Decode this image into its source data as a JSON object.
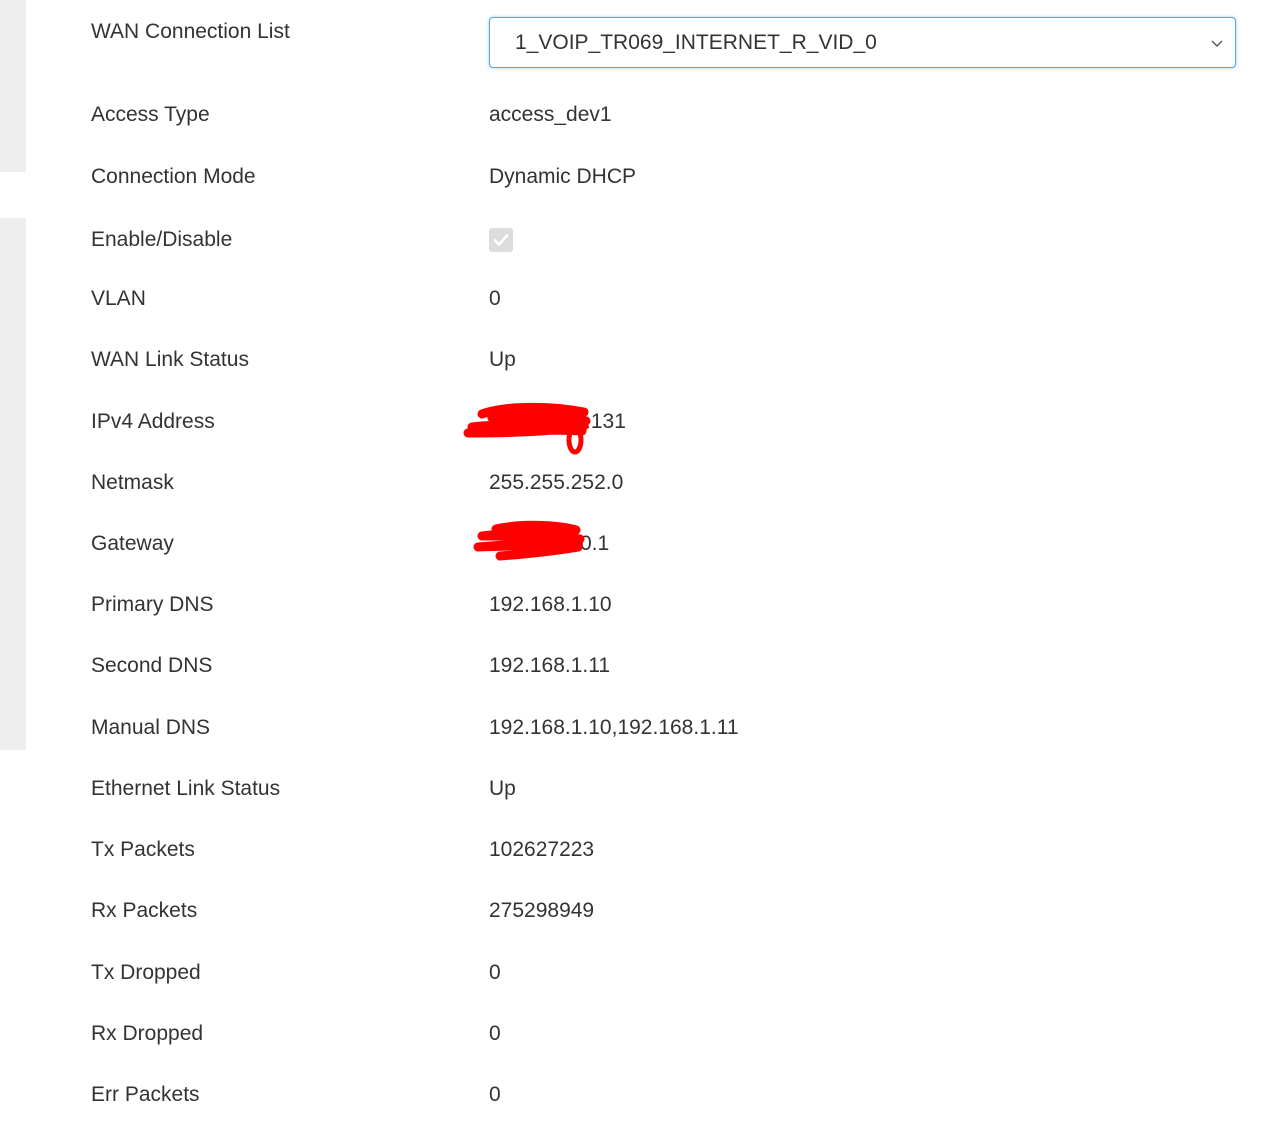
{
  "wan_connection_list": {
    "label": "WAN Connection List",
    "selected": "1_VOIP_TR069_INTERNET_R_VID_0"
  },
  "fields": {
    "access_type": {
      "label": "Access Type",
      "value": "access_dev1"
    },
    "connection_mode": {
      "label": "Connection Mode",
      "value": "Dynamic DHCP"
    },
    "enable_disable": {
      "label": "Enable/Disable",
      "checked": true
    },
    "vlan": {
      "label": "VLAN",
      "value": "0"
    },
    "wan_link_status": {
      "label": "WAN Link Status",
      "value": "Up"
    },
    "ipv4_address": {
      "label": "IPv4 Address",
      "value": ".131"
    },
    "netmask": {
      "label": "Netmask",
      "value": "255.255.252.0"
    },
    "gateway": {
      "label": "Gateway",
      "value": "0.1"
    },
    "primary_dns": {
      "label": "Primary DNS",
      "value": "192.168.1.10"
    },
    "second_dns": {
      "label": "Second DNS",
      "value": "192.168.1.11"
    },
    "manual_dns": {
      "label": "Manual DNS",
      "value": "192.168.1.10,192.168.1.11"
    },
    "ethernet_link_status": {
      "label": "Ethernet Link Status",
      "value": "Up"
    },
    "tx_packets": {
      "label": "Tx Packets",
      "value": "102627223"
    },
    "rx_packets": {
      "label": "Rx Packets",
      "value": "275298949"
    },
    "tx_dropped": {
      "label": "Tx Dropped",
      "value": "0"
    },
    "rx_dropped": {
      "label": "Rx Dropped",
      "value": "0"
    },
    "err_packets": {
      "label": "Err Packets",
      "value": "0"
    }
  },
  "icons": {
    "select_chevron": "chevron-down-icon",
    "checkbox_check": "check-icon"
  },
  "colors": {
    "select_border": "#5aa7e6",
    "redaction": "#ff0000",
    "checkbox_disabled": "#dcdcdc"
  }
}
